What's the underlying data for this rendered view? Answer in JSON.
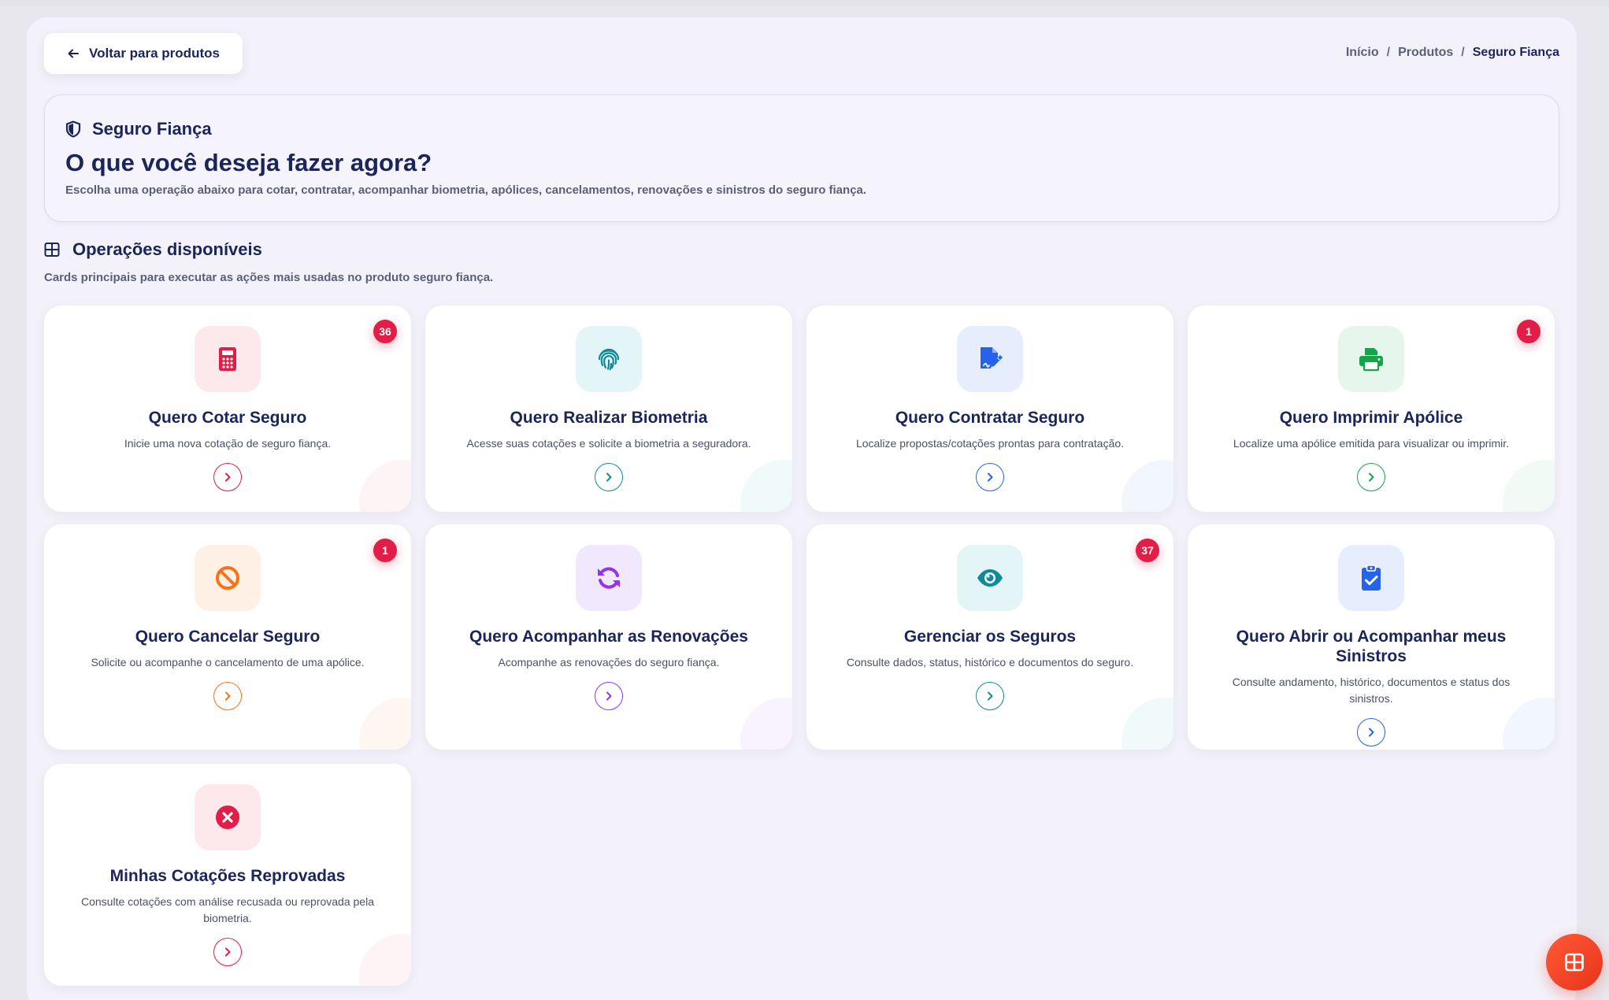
{
  "header": {
    "back_label": "Voltar para produtos",
    "breadcrumb": {
      "home": "Início",
      "products": "Produtos",
      "current": "Seguro Fiança",
      "separator": "/"
    }
  },
  "hero": {
    "tag": "Seguro Fiança",
    "title": "O que você deseja fazer agora?",
    "subtitle": "Escolha uma operação abaixo para cotar, contratar, acompanhar biometria, apólices, cancelamentos, renovações e sinistros do seguro fiança."
  },
  "operations": {
    "title": "Operações disponíveis",
    "subtitle": "Cards principais para executar as ações mais usadas no produto seguro fiança.",
    "cards": [
      {
        "title": "Quero Cotar Seguro",
        "desc": "Inicie uma nova cotação de seguro fiança.",
        "badge": "36",
        "icon": "calculator-icon",
        "color": "#e11d48",
        "bg": "#fde8ec"
      },
      {
        "title": "Quero Realizar Biometria",
        "desc": "Acesse suas cotações e solicite a biometria a seguradora.",
        "badge": "",
        "icon": "fingerprint-icon",
        "color": "#0e8a9a",
        "bg": "#e4f5f7"
      },
      {
        "title": "Quero Contratar Seguro",
        "desc": "Localize propostas/cotações prontas para contratação.",
        "badge": "",
        "icon": "file-signature-icon",
        "color": "#2563eb",
        "bg": "#e6eefd"
      },
      {
        "title": "Quero Imprimir Apólice",
        "desc": "Localize uma apólice emitida para visualizar ou imprimir.",
        "badge": "1",
        "icon": "printer-icon",
        "color": "#16a34a",
        "bg": "#e6f6ec"
      },
      {
        "title": "Quero Cancelar Seguro",
        "desc": "Solicite ou acompanhe o cancelamento de uma apólice.",
        "badge": "1",
        "icon": "ban-icon",
        "color": "#f97316",
        "bg": "#fef0e4"
      },
      {
        "title": "Quero Acompanhar as Renovações",
        "desc": "Acompanhe as renovações do seguro fiança.",
        "badge": "",
        "icon": "refresh-icon",
        "color": "#9333ea",
        "bg": "#f1e8fd"
      },
      {
        "title": "Gerenciar os Seguros",
        "desc": "Consulte dados, status, histórico e documentos do seguro.",
        "badge": "37",
        "icon": "eye-icon",
        "color": "#0e8a9a",
        "bg": "#e4f5f7"
      },
      {
        "title": "Quero Abrir ou Acompanhar meus Sinistros",
        "desc": "Consulte andamento, histórico, documentos e status dos sinistros.",
        "badge": "",
        "icon": "clipboard-check-icon",
        "color": "#2563eb",
        "bg": "#e6eefd"
      },
      {
        "title": "Minhas Cotações Reprovadas",
        "desc": "Consulte cotações com análise recusada ou reprovada pela biometria.",
        "badge": "",
        "icon": "circle-x-icon",
        "color": "#e11d48",
        "bg": "#fde8ec"
      }
    ]
  },
  "fab": {
    "icon": "grid-icon"
  }
}
